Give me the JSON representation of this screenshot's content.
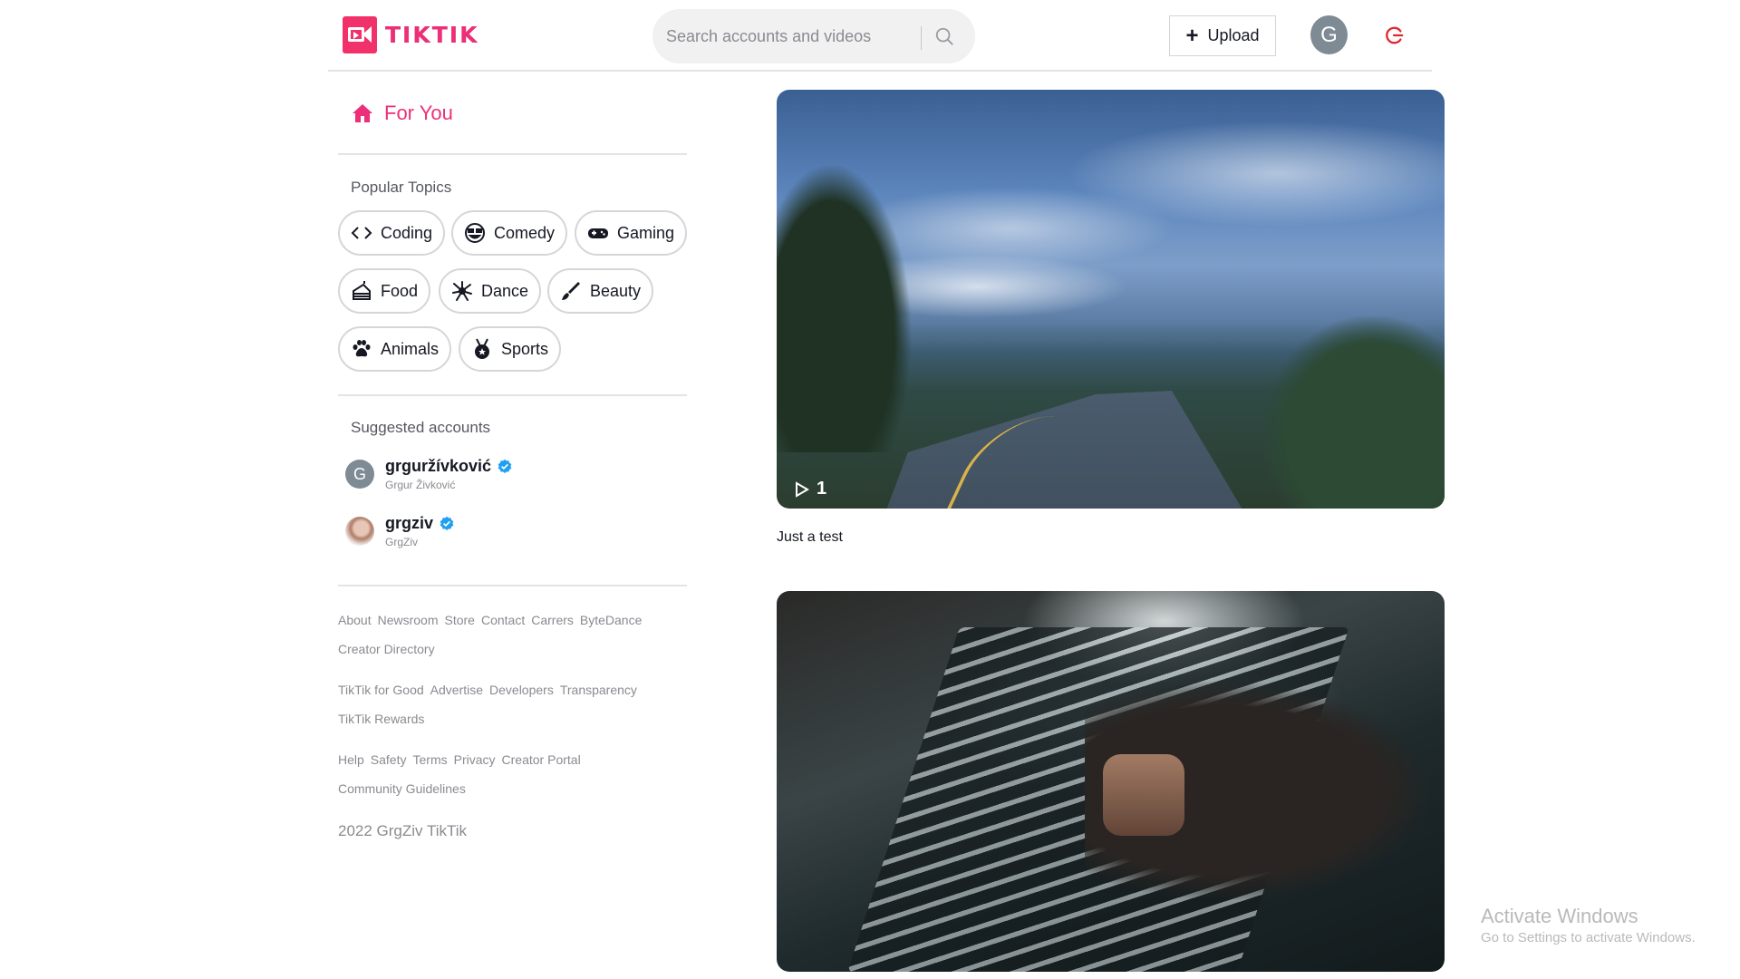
{
  "app": {
    "brand": "TIKTIK"
  },
  "header": {
    "search_placeholder": "Search accounts and videos",
    "upload_label": "Upload",
    "avatar_initial": "G"
  },
  "sidebar": {
    "for_you": "For You",
    "popular_topics_title": "Popular Topics",
    "topics": [
      {
        "label": "Coding",
        "icon": "code-icon"
      },
      {
        "label": "Comedy",
        "icon": "laughing-face-icon"
      },
      {
        "label": "Gaming",
        "icon": "gamepad-icon"
      },
      {
        "label": "Food",
        "icon": "cake-icon"
      },
      {
        "label": "Dance",
        "icon": "dance-icon"
      },
      {
        "label": "Beauty",
        "icon": "brush-icon"
      },
      {
        "label": "Animals",
        "icon": "paw-icon"
      },
      {
        "label": "Sports",
        "icon": "medal-icon"
      }
    ],
    "suggested_title": "Suggested accounts",
    "accounts": [
      {
        "handle": "grguržívković",
        "name": "Grgur Živković",
        "initial": "G"
      },
      {
        "handle": "grgziv",
        "name": "GrgZiv"
      }
    ],
    "footer": {
      "group1": [
        "About",
        "Newsroom",
        "Store",
        "Contact",
        "Carrers",
        "ByteDance",
        "Creator Directory"
      ],
      "group2": [
        "TikTik for Good",
        "Advertise",
        "Developers",
        "Transparency",
        "TikTik Rewards"
      ],
      "group3": [
        "Help",
        "Safety",
        "Terms",
        "Privacy",
        "Creator Portal",
        "Community Guidelines"
      ],
      "copyright": "2022 GrgZiv TikTik"
    }
  },
  "feed": {
    "videos": [
      {
        "play_count": "1",
        "caption": "Just a test"
      },
      {
        "caption": ""
      }
    ]
  },
  "watermark": {
    "line1": "Activate Windows",
    "line2": "Go to Settings to activate Windows."
  },
  "colors": {
    "accent": "#ec2f78",
    "verified": "#20a0f0"
  }
}
